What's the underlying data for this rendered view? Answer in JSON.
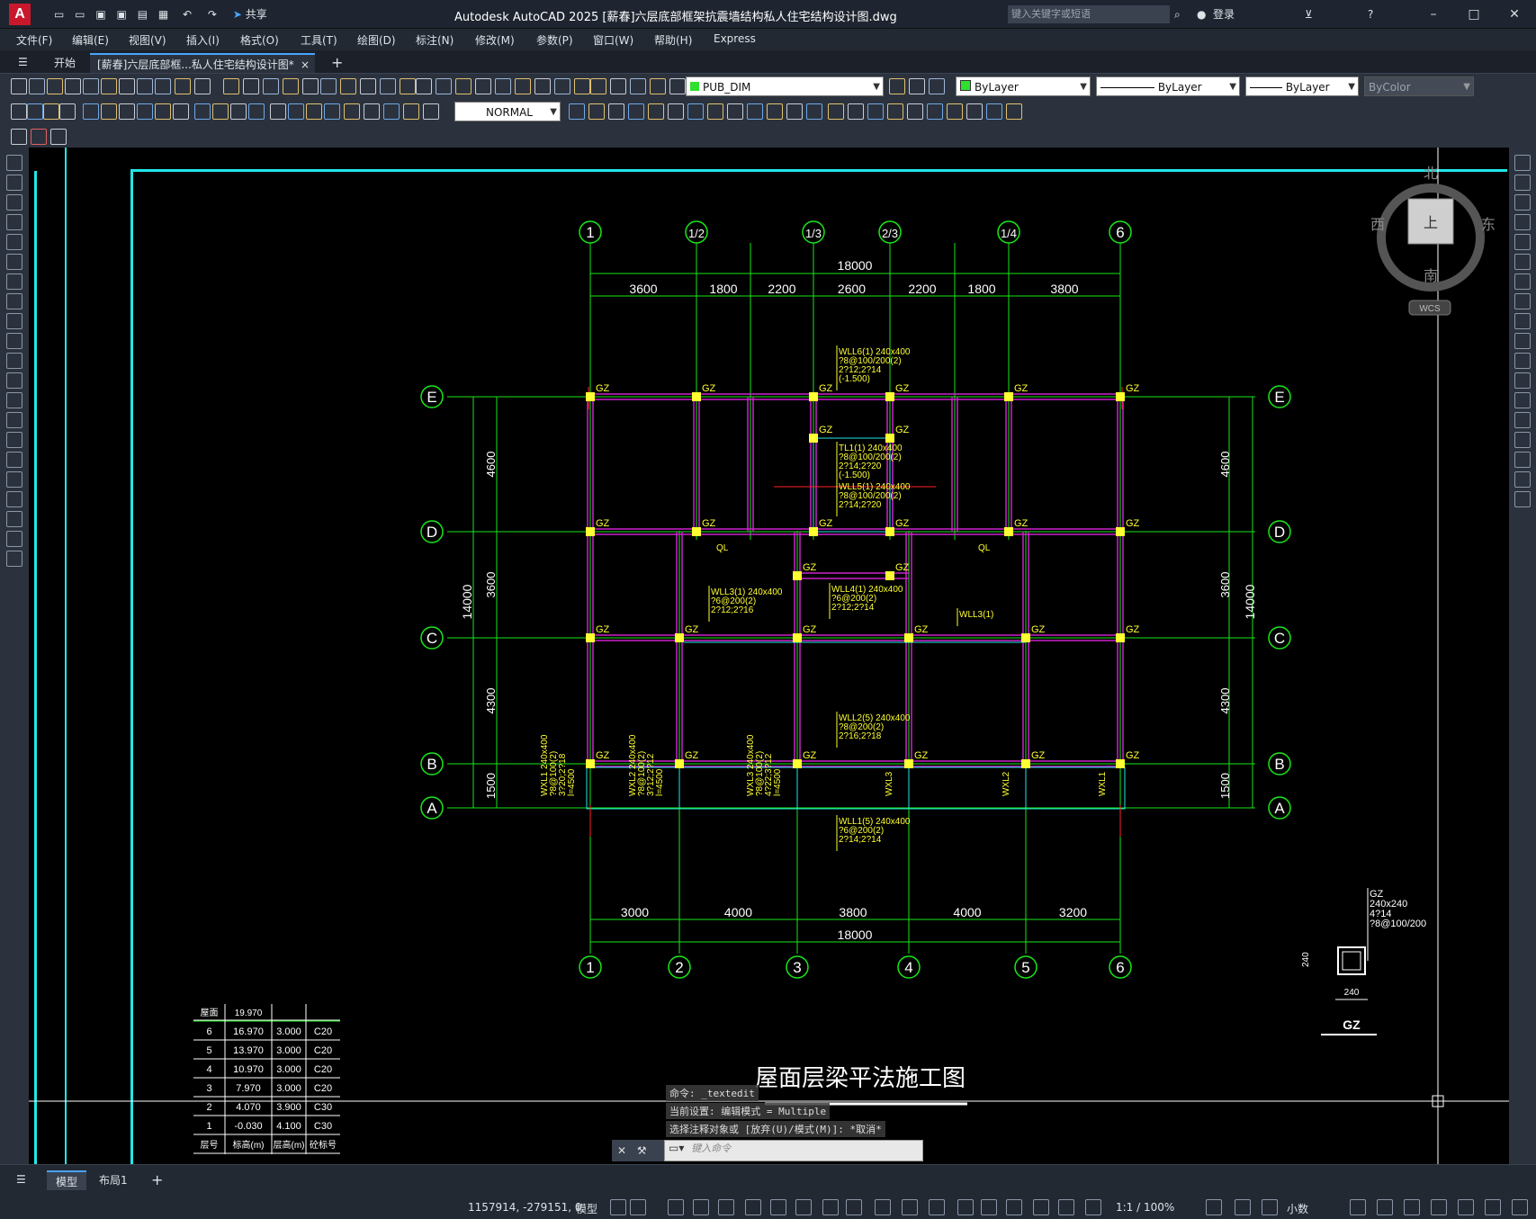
{
  "app": {
    "logo": "A",
    "title": "Autodesk AutoCAD 2025    [薪春]六层底部框架抗震墙结构私人住宅结构设计图.dwg",
    "share": "共享",
    "search_placeholder": "键入关键字或短语",
    "login": "登录"
  },
  "menu": [
    "文件(F)",
    "编辑(E)",
    "视图(V)",
    "插入(I)",
    "格式(O)",
    "工具(T)",
    "绘图(D)",
    "标注(N)",
    "修改(M)",
    "参数(P)",
    "窗口(W)",
    "帮助(H)",
    "Express"
  ],
  "tabs": {
    "start": "开始",
    "doc": "[薪春]六层底部框...私人住宅结构设计图*",
    "close": "×",
    "add": "+"
  },
  "toolbar": {
    "layer": "PUB_DIM",
    "color": "ByLayer",
    "linetype": "ByLayer",
    "lineweight": "ByLayer",
    "plotstyle": "ByColor",
    "textstyle": "NORMAL"
  },
  "viewcube": {
    "north": "北",
    "south": "南",
    "east": "东",
    "west": "西",
    "face": "上",
    "wcs": "WCS"
  },
  "drawing": {
    "title": "屋面层梁平法施工图",
    "top_axes": [
      "1",
      "1/2",
      "1/3",
      "2/3",
      "1/4",
      "6"
    ],
    "bottom_axes": [
      "1",
      "2",
      "3",
      "4",
      "5",
      "6"
    ],
    "side_axes": [
      "E",
      "D",
      "C",
      "B",
      "A"
    ],
    "top_total": "18000",
    "top_dims": [
      "3600",
      "1800",
      "2200",
      "2600",
      "2200",
      "1800",
      "3800"
    ],
    "bottom_dims": [
      "3000",
      "4000",
      "3800",
      "4000",
      "3200"
    ],
    "bottom_total": "18000",
    "left_dims": [
      "4600",
      "3600",
      "4300",
      "1500"
    ],
    "left_total": "14000",
    "column_label": "GZ",
    "beam_labels": [
      [
        "WLL6(1) 240x400",
        "?8@100/200(2)",
        "2?12;2?14",
        "(-1.500)"
      ],
      [
        "TL1(1) 240x400",
        "?8@100/200(2)",
        "2?14;2?20",
        "(-1.500)"
      ],
      [
        "WLL5(1) 240x400",
        "?8@100/200(2)",
        "2?14;2?20"
      ],
      [
        "WLL3(1) 240x400",
        "?6@200(2)",
        "2?12;2?16"
      ],
      [
        "WLL4(1) 240x400",
        "?6@200(2)",
        "2?12;2?14"
      ],
      [
        "WLL3(1)"
      ],
      [
        "WLL2(5) 240x400",
        "?8@200(2)",
        "2?16;2?18"
      ],
      [
        "WLL1(5) 240x400",
        "?6@200(2)",
        "2?14;2?14"
      ]
    ],
    "ql": "QL",
    "vert_labels": [
      [
        "WXL1 240x400",
        "?8@100(2)",
        "3?20;2?18",
        "l=4500"
      ],
      [
        "WXL2 240x400",
        "?8@100(2)",
        "3?12;2?12",
        "l=4500"
      ],
      [
        "WXL3 240x400",
        "?8@100(2)",
        "4?22;3?12",
        "l=4500"
      ]
    ],
    "vert_short": [
      "WXL3",
      "WXL2",
      "WXL1"
    ],
    "gz_detail": {
      "lines": [
        "GZ",
        "240x240",
        "4?14",
        "?8@100/200"
      ],
      "dim": "240",
      "name": "GZ"
    },
    "floor_table": {
      "top_row": [
        "屋面",
        "19.970",
        "",
        ""
      ],
      "rows": [
        [
          "6",
          "16.970",
          "3.000",
          "C20"
        ],
        [
          "5",
          "13.970",
          "3.000",
          "C20"
        ],
        [
          "4",
          "10.970",
          "3.000",
          "C20"
        ],
        [
          "3",
          "7.970",
          "3.000",
          "C20"
        ],
        [
          "2",
          "4.070",
          "3.900",
          "C30"
        ],
        [
          "1",
          "-0.030",
          "4.100",
          "C30"
        ]
      ],
      "header": [
        "层号",
        "标高(m)",
        "层高(m)",
        "砼标号"
      ]
    }
  },
  "command": {
    "history": [
      "命令: _textedit",
      "当前设置: 编辑模式 = Multiple",
      "选择注释对象或 [放弃(U)/模式(M)]: *取消*"
    ],
    "placeholder": "键入命令"
  },
  "status": {
    "tabs": [
      "模型",
      "布局1"
    ],
    "coords": "1157914, -279151, 0",
    "model": "模型",
    "scale": "1:1 / 100%",
    "units": "小数"
  }
}
